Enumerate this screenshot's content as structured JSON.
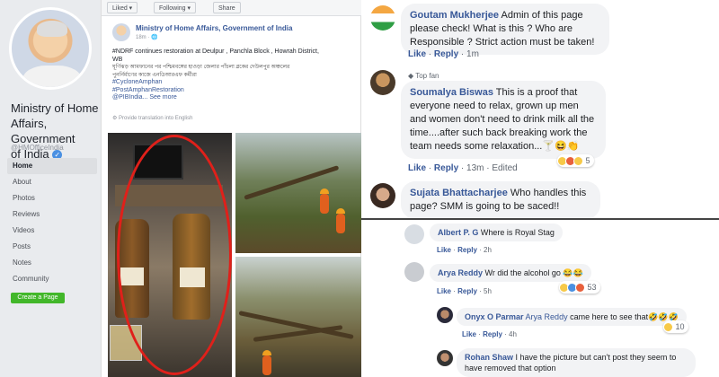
{
  "sidebar": {
    "page_name_line1": "Ministry of Home",
    "page_name_line2": "Affairs, Government",
    "page_name_line3": "of India",
    "handle": "@HMOfficeIndia",
    "nav": [
      "Home",
      "About",
      "Photos",
      "Reviews",
      "Videos",
      "Posts",
      "Notes",
      "Community"
    ],
    "create_page": "Create a Page"
  },
  "post": {
    "toolbar": {
      "liked": "Liked ▾",
      "following": "Following ▾",
      "share": "Share"
    },
    "author": "Ministry of Home Affairs, Government of India",
    "time": "18m · 🌐",
    "text_line1": "#NDRF continues restoration at Deulpur , Panchla Block , Howrah District,",
    "text_line2": "WB",
    "bengali_line1": "ঘূর্ণিঝড় আমফানের পর পশ্চিমবঙ্গের হাওড়া জেলার পাঁচলা ব্লকের দেউলপুর অঞ্চলের",
    "bengali_line2": "পুনর্নির্মাণের কাজে এনডিআরএফ কর্মীরা",
    "tag1": "#CycloneAmphan",
    "tag2": "#PostAmphanRestoration",
    "tag3": "@PIBIndia...",
    "see_more": "See more",
    "translate": "Provide translation into English"
  },
  "comments_top": [
    {
      "name": "Goutam Mukherjee",
      "text": "Admin of this page please check! What is this ? Who are Responsible ? Strict action must be taken!",
      "like": "Like",
      "reply": "Reply",
      "time": "1m"
    },
    {
      "badge": "Top fan",
      "name": "Soumalya Biswas",
      "text": "This is a proof that everyone need to relax, grown up men and women don't need to drink milk all the time....after such back breaking work the team needs some relaxation...🍸😆👏",
      "like": "Like",
      "reply": "Reply",
      "time": "13m",
      "edited": "Edited",
      "react_count": "5"
    },
    {
      "name": "Sujata Bhattacharjee",
      "text": "Who handles this page? SMM is going to be saced!!"
    }
  ],
  "comments_bottom": [
    {
      "name": "Albert P. G",
      "text": "Where is Royal Stag",
      "like": "Like",
      "reply": "Reply",
      "time": "2h"
    },
    {
      "name": "Arya Reddy",
      "text": "Wr did the alcohol go 😂😂",
      "like": "Like",
      "reply": "Reply",
      "time": "5h",
      "react_count": "53"
    },
    {
      "name": "Onyx O Parmar",
      "mention": "Arya Reddy",
      "text": "came here to see that🤣🤣🤣",
      "like": "Like",
      "reply": "Reply",
      "time": "4h",
      "react_count": "10"
    },
    {
      "name": "Rohan Shaw",
      "text": "I have the picture but can't post they seem to have removed that option"
    }
  ],
  "colors": {
    "link": "#385898",
    "ellipse": "#e0201a",
    "create_button": "#42b72a"
  }
}
